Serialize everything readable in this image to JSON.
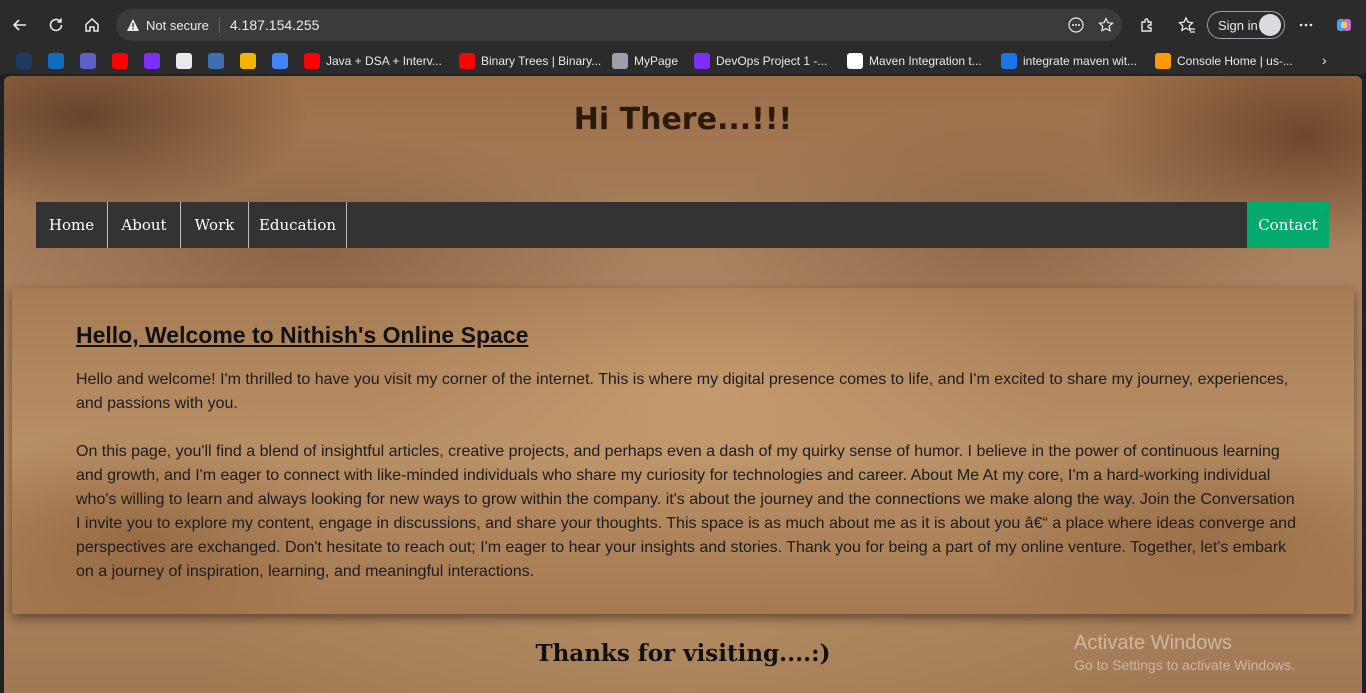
{
  "browser": {
    "address": {
      "security_label": "Not secure",
      "url": "4.187.154.255"
    },
    "signin_label": "Sign in",
    "bookmarks": [
      {
        "label": "",
        "color": "#1f3a5f"
      },
      {
        "label": "",
        "color": "#0f6cbd"
      },
      {
        "label": "",
        "color": "#5b5fc7"
      },
      {
        "label": "",
        "color": "#ff0000"
      },
      {
        "label": "",
        "color": "#7b2ff7"
      },
      {
        "label": "",
        "color": "#e8eaed"
      },
      {
        "label": "",
        "color": "#3c6fb0"
      },
      {
        "label": "",
        "color": "#f4b400"
      },
      {
        "label": "",
        "color": "#4285f4"
      },
      {
        "label": "Java + DSA + Interv...",
        "color": "#ff0000"
      },
      {
        "label": "Binary Trees | Binary...",
        "color": "#ff0000"
      },
      {
        "label": "MyPage",
        "color": "#9aa0a6"
      },
      {
        "label": "DevOps Project 1 -...",
        "color": "#7b2ff7"
      },
      {
        "label": "Maven Integration t...",
        "color": "#ffffff"
      },
      {
        "label": "integrate maven wit...",
        "color": "#1a73e8"
      },
      {
        "label": "Console Home | us-...",
        "color": "#ff9900"
      }
    ]
  },
  "page": {
    "hero_title": "Hi There...!!!",
    "nav": {
      "items": [
        {
          "label": "Home",
          "width": 72
        },
        {
          "label": "About",
          "width": 73
        },
        {
          "label": "Work",
          "width": 68
        },
        {
          "label": "Education",
          "width": 98
        }
      ],
      "contact_label": "Contact",
      "contact_color": "#04aa6d"
    },
    "card": {
      "heading": "Hello, Welcome to Nithish's Online Space",
      "paragraph1": "Hello and welcome! I'm thrilled to have you visit my corner of the internet. This is where my digital presence comes to life, and I'm excited to share my journey, experiences, and passions with you.",
      "paragraph2": "On this page, you'll find a blend of insightful articles, creative projects, and perhaps even a dash of my quirky sense of humor. I believe in the power of continuous learning and growth, and I'm eager to connect with like-minded individuals who share my curiosity for technologies and career. About Me At my core, I'm a hard-working individual who's willing to learn and always looking for new ways to grow within the company. it's about the journey and the connections we make along the way. Join the Conversation I invite you to explore my content, engage in discussions, and share your thoughts. This space is as much about me as it is about you â€“ a place where ideas converge and perspectives are exchanged. Don't hesitate to reach out; I'm eager to hear your insights and stories. Thank you for being a part of my online venture. Together, let's embark on a journey of inspiration, learning, and meaningful interactions."
    },
    "footer_text": "Thanks for visiting....:)",
    "watermark": {
      "line1": "Activate Windows",
      "line2": "Go to Settings to activate Windows."
    }
  }
}
